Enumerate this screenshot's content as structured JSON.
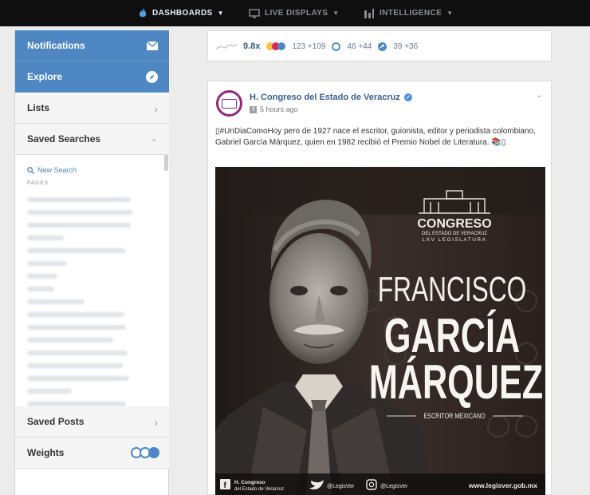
{
  "topnav": {
    "items": [
      {
        "label": "DASHBOARDS",
        "icon": "flame-icon",
        "active": true
      },
      {
        "label": "LIVE DISPLAYS",
        "icon": "monitor-icon",
        "active": false
      },
      {
        "label": "INTELLIGENCE",
        "icon": "bar-chart-icon",
        "active": false
      }
    ]
  },
  "sidebar": {
    "notifications": "Notifications",
    "explore": "Explore",
    "lists": "Lists",
    "saved_searches": "Saved Searches",
    "new_search": "New Search",
    "pages_label": "PAGES",
    "saved_posts": "Saved Posts",
    "weights": "Weights"
  },
  "stats_card": {
    "overperforming": "9.8x",
    "reactions": "123 +109",
    "comments": "46 +44",
    "shares": "39 +36"
  },
  "post": {
    "page_name": "H. Congreso del Estado de Veracruz",
    "time": "5 hours ago",
    "text": "▯#UnDiaComoHoy pero de 1927 nace el escritor, guionista, editor y periodista colombiano, Gabriel García Márquez, quien en 1982 recibió el Premio Nobel de Literatura. 📚▯",
    "image": {
      "congreso": "CONGRESO",
      "estado": "DEL ESTADO DE VERACRUZ",
      "legislatura": "LXV LEGISLATURA",
      "name_1": "FRANCISCO",
      "name_2": "GARCÍA",
      "name_3": "MÁRQUEZ",
      "subtitle": "ESCRITOR MEXICANO",
      "footer_fb_1": "H. Congreso",
      "footer_fb_2": "del Estado de Veracruz",
      "footer_tw": "@LegisVer",
      "footer_ig": "@LegisVer",
      "footer_web": "www.legisver.gob.mx"
    }
  },
  "colors": {
    "accent": "#4e87c2",
    "topbar": "#0f0f10",
    "link": "#3b5f8a"
  }
}
